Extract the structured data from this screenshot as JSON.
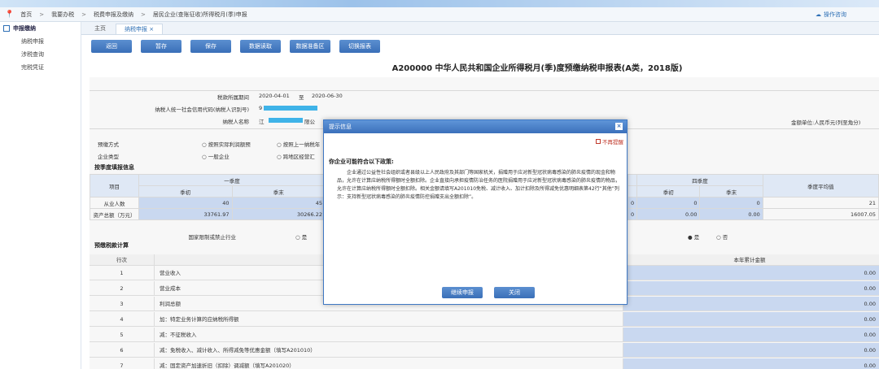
{
  "header": {
    "brand": "",
    "help_label": "操作咨询"
  },
  "breadcrumb": [
    "首页",
    "我要办税",
    "税费申报及缴纳",
    "居民企业(查账征收)所得税月(季)申报"
  ],
  "sidebar": {
    "section_label": "申报缴纳",
    "items": [
      "纳税申报",
      "涉税查询",
      "完税凭证"
    ]
  },
  "tabs": [
    "主页",
    "纳税申报 ×"
  ],
  "toolbar": [
    "返回",
    "暂存",
    "保存",
    "数据读取",
    "数据准备区",
    "切换报表"
  ],
  "form": {
    "title": "A200000 中华人民共和国企业所得税月(季)度预缴纳税申报表(A类，2018版)",
    "period_label": "税款所属期间",
    "period_start": "2020-04-01",
    "period_to": "至",
    "period_end": "2020-06-30",
    "taxpayer_id_label": "纳税人统一社会信用代码(纳税人识别号)",
    "taxpayer_id_prefix": "9",
    "taxpayer_name_label": "纳税人名称",
    "taxpayer_name_prefix": "江",
    "taxpayer_name_suffix": "限公",
    "unit_label": "金额单位:人民币元(列至角分)",
    "method_label": "预缴方式",
    "method_opt1": "按照实际利润额预",
    "method_opt2": "按照上一纳税年",
    "enterprise_type_label": "企业类型",
    "enterprise_opt1": "一般企业",
    "enterprise_opt2": "跨地区经营汇",
    "quarter_section": "按季度填报信息",
    "item_label": "项目",
    "q1_label": "一季度",
    "q4_label": "四季度",
    "avg_label": "季度平均值",
    "begin_label": "季初",
    "end_label": "季末",
    "employees_label": "从业人数",
    "assets_label": "资产总额（万元）",
    "emp_q1_begin": "40",
    "emp_q1_end": "45",
    "emp_q4_tail": "0",
    "emp_q4_begin": "0",
    "emp_q4_end": "0",
    "emp_avg": "21",
    "assets_q1_begin": "33761.97",
    "assets_q1_end": "30266.22",
    "assets_q4_tail": "0",
    "assets_q4_begin": "0.00",
    "assets_q4_end": "0.00",
    "assets_avg": "16007.05",
    "restricted_label": "国家限制或禁止行业",
    "yes_label": "是",
    "no_label": "否",
    "calc_section": "预缴税款计算",
    "row_no_label": "行次",
    "cumulative_label": "本年累计金额",
    "rows": [
      {
        "no": "1",
        "desc": "营业收入",
        "amount": "0.00"
      },
      {
        "no": "2",
        "desc": "营业成本",
        "amount": "0.00"
      },
      {
        "no": "3",
        "desc": "利润总额",
        "amount": "0.00"
      },
      {
        "no": "4",
        "desc": "加：特定业务计算的应纳税所得额",
        "amount": "0.00"
      },
      {
        "no": "5",
        "desc": "减：不征税收入",
        "amount": "0.00"
      },
      {
        "no": "6",
        "desc": "减：免税收入、减计收入、所得减免等优惠金额（填写A201010）",
        "amount": "0.00"
      },
      {
        "no": "7",
        "desc": "减：固定资产加速折旧（扣除）调减额（填写A201020）",
        "amount": "0.00"
      }
    ]
  },
  "dialog": {
    "title": "提示信息",
    "no_remind": "不再提醒",
    "heading": "你企业可能符合以下政策:",
    "body": "企业通过公益性社会组织或者县级以上人民政府及其部门等国家机关，捐赠用于应对新型冠状病毒感染的肺炎疫情的现金和物品，允许在计算应纳税所得额时全额扣除。企业直接向承担疫情防治任务的医院捐赠用于应对新型冠状病毒感染的肺炎疫情的物品，允许在计算应纳税所得额时全额扣除。相关金额请填写A201010免税、减计收入、加计扣除及所得减免优惠明细表第42行“其他”列示：支持新型冠状病毒感染的肺炎疫情防控捐赠支出全额扣除”。",
    "continue_label": "继续申报",
    "close_label": "关闭"
  },
  "colors": {
    "accent": "#3a6fb8",
    "redact": "#3fb3e8",
    "cell_blue": "#c9d8f0"
  }
}
